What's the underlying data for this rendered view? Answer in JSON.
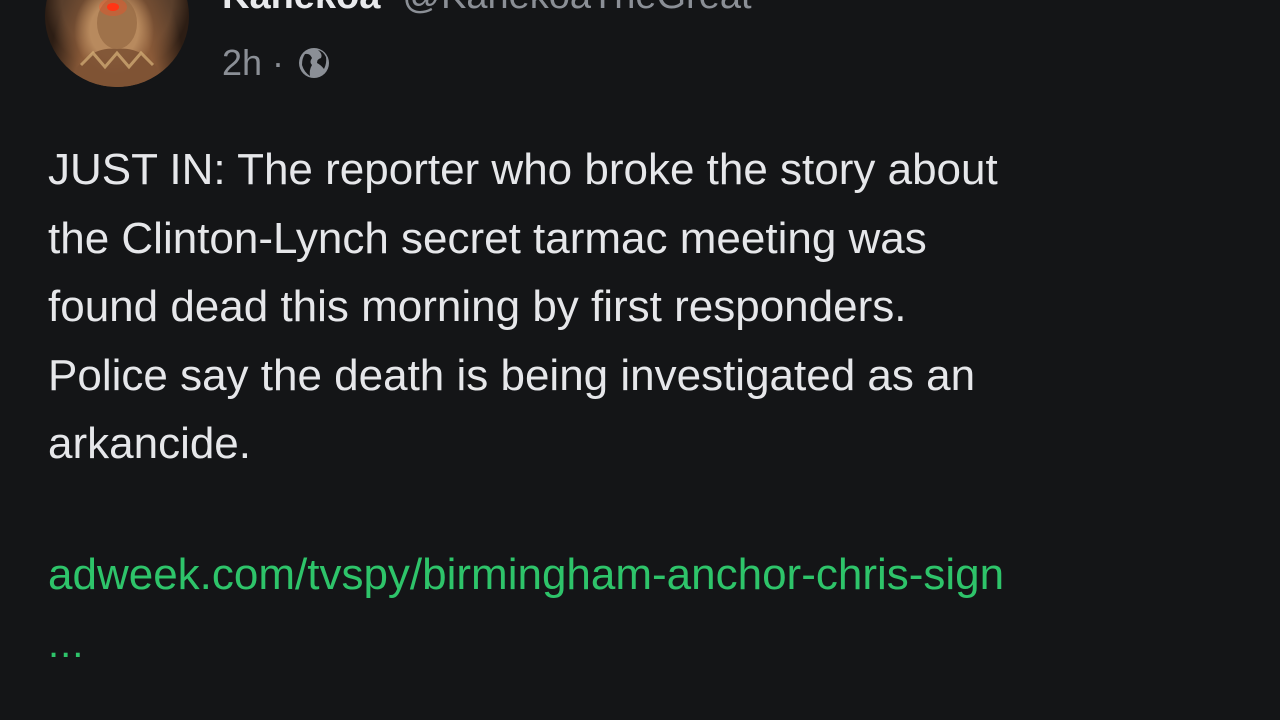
{
  "post": {
    "author": {
      "display_name": "Kanekoa",
      "handle": "@KanekoaTheGreat",
      "avatar_icon": "avatar-image"
    },
    "meta": {
      "time": "2h",
      "separator": "·",
      "visibility_icon": "globe-icon"
    },
    "text": "JUST IN: The reporter who broke the story about\nthe Clinton-Lynch secret tarmac meeting was\nfound dead this morning by first responders.\nPolice say the death is being investigated as an\narkancide.",
    "link": {
      "label": "adweek.com/tvspy/birmingham-anchor-chris-sign",
      "more": "..."
    }
  },
  "colors": {
    "background": "#141517",
    "text": "#e6e7ea",
    "muted": "#8b8f96",
    "link": "#2ec46a"
  }
}
